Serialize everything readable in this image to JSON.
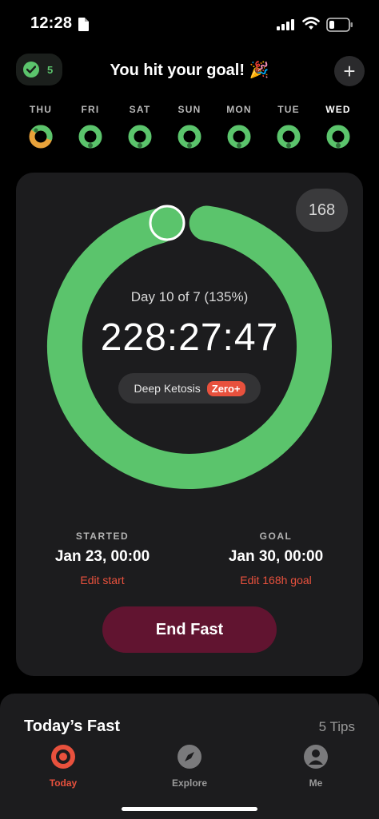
{
  "status_bar": {
    "time": "12:28"
  },
  "header": {
    "streak_count": "5",
    "title": "You hit your goal! 🎉",
    "add_label": "+"
  },
  "week": [
    {
      "label": "THU",
      "state": "partial"
    },
    {
      "label": "FRI",
      "state": "complete"
    },
    {
      "label": "SAT",
      "state": "complete"
    },
    {
      "label": "SUN",
      "state": "complete"
    },
    {
      "label": "MON",
      "state": "complete"
    },
    {
      "label": "TUE",
      "state": "complete"
    },
    {
      "label": "WED",
      "state": "complete",
      "active": true
    }
  ],
  "timer": {
    "plan_badge": "168",
    "progress_label": "Day 10 of 7 (135%)",
    "progress_fraction": 1.0,
    "elapsed": "228:27:47",
    "stage": "Deep Ketosis",
    "stage_tag": "Zero+"
  },
  "started": {
    "caption": "STARTED",
    "value": "Jan 23, 00:00",
    "edit": "Edit start"
  },
  "goal": {
    "caption": "GOAL",
    "value": "Jan 30, 00:00",
    "edit": "Edit 168h goal"
  },
  "end_button": "End Fast",
  "section": {
    "title": "Today’s Fast",
    "tips": "5 Tips"
  },
  "nav": {
    "today": "Today",
    "explore": "Explore",
    "me": "Me"
  },
  "colors": {
    "accent_green": "#5bc46c",
    "accent_orange": "#e8513d",
    "end_button": "#611430",
    "card_bg": "#1c1c1e"
  }
}
